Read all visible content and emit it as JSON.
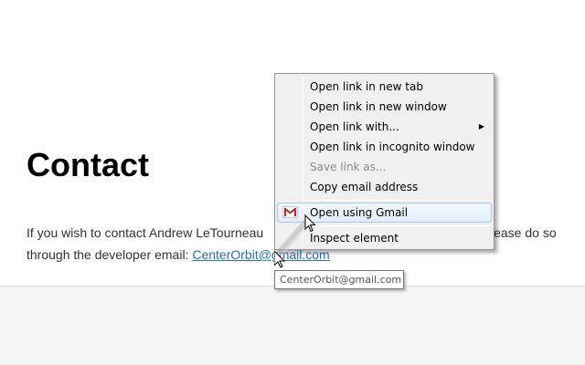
{
  "page": {
    "heading": "Contact",
    "paragraph": {
      "line1_start": "If you wish to contact Andrew LeTourneau",
      "line1_end": "lease do so",
      "line2_prefix": "through the developer email: ",
      "email_link": "CenterOrbit@gmail.com"
    }
  },
  "context_menu": {
    "items": [
      {
        "label": "Open link in new tab"
      },
      {
        "label": "Open link in new window"
      },
      {
        "label": "Open link with..."
      },
      {
        "label": "Open link in incognito window"
      },
      {
        "label": "Save link as..."
      },
      {
        "label": "Copy email address"
      },
      {
        "label": "Open using Gmail"
      },
      {
        "label": "Inspect element"
      }
    ],
    "gmail_icon": "gmail-icon",
    "submenu_arrow": "▶"
  },
  "tooltip": {
    "text": "CenterOrbit@gmail.com"
  },
  "colors": {
    "link": "#2a6ebf",
    "menu_bg": "#f0f0f0",
    "highlight_border": "#a8c8ea",
    "gmail_red": "#c5281c"
  }
}
